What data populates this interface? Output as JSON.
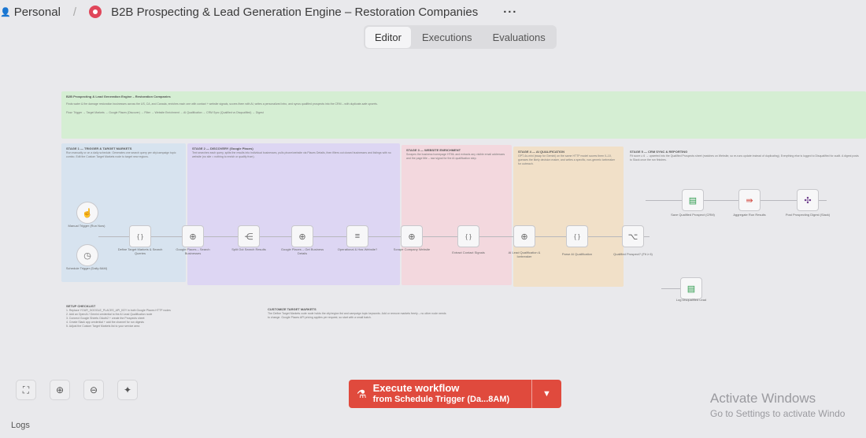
{
  "header": {
    "project": "Personal",
    "workflow_title": "B2B Prospecting & Lead Generation Engine – Restoration Companies",
    "more": "···"
  },
  "tabs": [
    {
      "label": "Editor",
      "active": true
    },
    {
      "label": "Executions",
      "active": false
    },
    {
      "label": "Evaluations",
      "active": false
    }
  ],
  "canvas": {
    "note_top": {
      "title": "B2B Prospecting & Lead Generation Engine – Restoration Companies",
      "line1": "Finds water & fire damage restoration businesses across the US, CA, and Canada, enriches each one with contact + website signals, scores them with AI, writes a personalized intro, and syncs qualified prospects into the CRM – with duplicate-safe upserts.",
      "line2": "Flow: Trigger → Target Markets → Google Places (Discover) → Filter → Website Enrichment → AI Qualification → CRM Sync (Qualified vs Disqualified) → Digest"
    },
    "stages": [
      {
        "title": "STAGE 1 — TRIGGER & TARGET MARKETS",
        "text": "Run manually or on a daily schedule. Generates one search query per city/campaign topic combo. Edit the Custom Target Markets node to target new regions."
      },
      {
        "title": "STAGE 2 — DISCOVERY (Google Places)",
        "text": "Text searches each query, splits the results into individual businesses, pulls phone/website via Places Details, then filters out closed businesses and listings with no website (no site = nothing to enrich or qualify from)."
      },
      {
        "title": "STAGE 3 — WEBSITE ENRICHMENT",
        "text": "Scrapes the business homepage HTML and extracts any visible email addresses and the page title – raw signal for the AI qualification step."
      },
      {
        "title": "STAGE 4 — AI QUALIFICATION",
        "text": "GPT-4o-mini (swap for Gemini) on the same HTTP model scores them 0–10, guesses the likely decision maker, and writes a specific, non-generic icebreaker for outreach."
      },
      {
        "title": "STAGE 5 — CRM SYNC & REPORTING",
        "text": "Fit score ≥ 6 → upserted into the Qualified Prospects sheet (matches on Website, so re-runs update instead of duplicating). Everything else is logged to Disqualified for audit. A digest posts to Slack once the run finishes."
      }
    ],
    "nodes": [
      {
        "name": "manual-trigger-node",
        "icon": "hand-icon",
        "glyph": "☝",
        "label": "Manual Trigger (Run Now)"
      },
      {
        "name": "schedule-trigger-node",
        "icon": "clock-icon",
        "glyph": "◷",
        "label": "Schedule Trigger (Daily 8AM)"
      },
      {
        "name": "define-target-node",
        "icon": "code-icon",
        "glyph": "{ }",
        "label": "Define Target Markets & Search Queries"
      },
      {
        "name": "places-search-node",
        "icon": "globe-icon",
        "glyph": "⊕",
        "label": "Google Places – Search Businesses"
      },
      {
        "name": "split-results-node",
        "icon": "split-icon",
        "glyph": "⋲",
        "label": "Split Out Search Results"
      },
      {
        "name": "places-details-node",
        "icon": "globe-icon",
        "glyph": "⊕",
        "label": "Google Places – Get Business Details"
      },
      {
        "name": "filter-node",
        "icon": "filter-icon",
        "glyph": "≡",
        "label": "Operational & Has Website?"
      },
      {
        "name": "scrape-website-node",
        "icon": "globe-icon",
        "glyph": "⊕",
        "label": "Scrape Company Website"
      },
      {
        "name": "extract-contact-node",
        "icon": "code-icon",
        "glyph": "{ }",
        "label": "Extract Contact Signals"
      },
      {
        "name": "ai-qualify-node",
        "icon": "globe-icon",
        "glyph": "⊕",
        "label": "AI Lead Qualification & Icebreaker"
      },
      {
        "name": "parse-ai-node",
        "icon": "code-icon",
        "glyph": "{ }",
        "label": "Parse AI Qualification"
      },
      {
        "name": "qualified-if-node",
        "icon": "branch-icon",
        "glyph": "⌥",
        "label": "Qualified Prospect? (Fit ≥ 6)"
      },
      {
        "name": "save-qualified-node",
        "icon": "sheet-icon",
        "glyph": "▤",
        "label": "Save Qualified Prospect (CRM)"
      },
      {
        "name": "aggregate-node",
        "icon": "aggregate-icon",
        "glyph": "⇛",
        "label": "Aggregate Run Results"
      },
      {
        "name": "slack-digest-node",
        "icon": "slack-icon",
        "glyph": "✣",
        "label": "Post Prospecting Digest (Slack)"
      },
      {
        "name": "log-disqualified-node",
        "icon": "sheet-icon",
        "glyph": "▤",
        "label": "Log Disqualified Lead"
      }
    ],
    "setup_note": {
      "title": "SETUP CHECKLIST",
      "items": [
        "1. Replace YOUR_GOOGLE_PLACES_API_KEY in both Google Places HTTP nodes",
        "2. Add an OpenAI / Gemini credential to the AI Lead Qualification node",
        "3. Connect Google Sheets OAuth2 + create the Prospects sheet",
        "4. Create Slack app credential + add the channel for run digests",
        "5. Adjust the Custom Target Markets list to your service area"
      ]
    },
    "markets_note": {
      "title": "CUSTOMIZE TARGET MARKETS",
      "text": "The Define Target Markets code node holds the city/region list and campaign topic keywords. Add or remove markets freely – no other node needs to change. Google Places API pricing applies per request, so start with a small batch."
    }
  },
  "toolbar": {
    "fit_icon": "fit-view-icon",
    "zoom_in_icon": "zoom-in-icon",
    "zoom_out_icon": "zoom-out-icon",
    "tidy_icon": "tidy-up-icon"
  },
  "execute": {
    "title": "Execute workflow",
    "subtitle": "from Schedule Trigger (Da...8AM)"
  },
  "watermark": {
    "line1": "Activate Windows",
    "line2": "Go to Settings to activate Windo"
  },
  "logs_label": "Logs",
  "colors": {
    "execute_bg": "#e04a3d",
    "stage1": "#d7e3ef",
    "stage2": "#ddd6f3",
    "stage3": "#f3d8de",
    "stage4": "#f1e0c8",
    "stage5": "#e3e3e7",
    "top_note": "#d5eed3"
  }
}
